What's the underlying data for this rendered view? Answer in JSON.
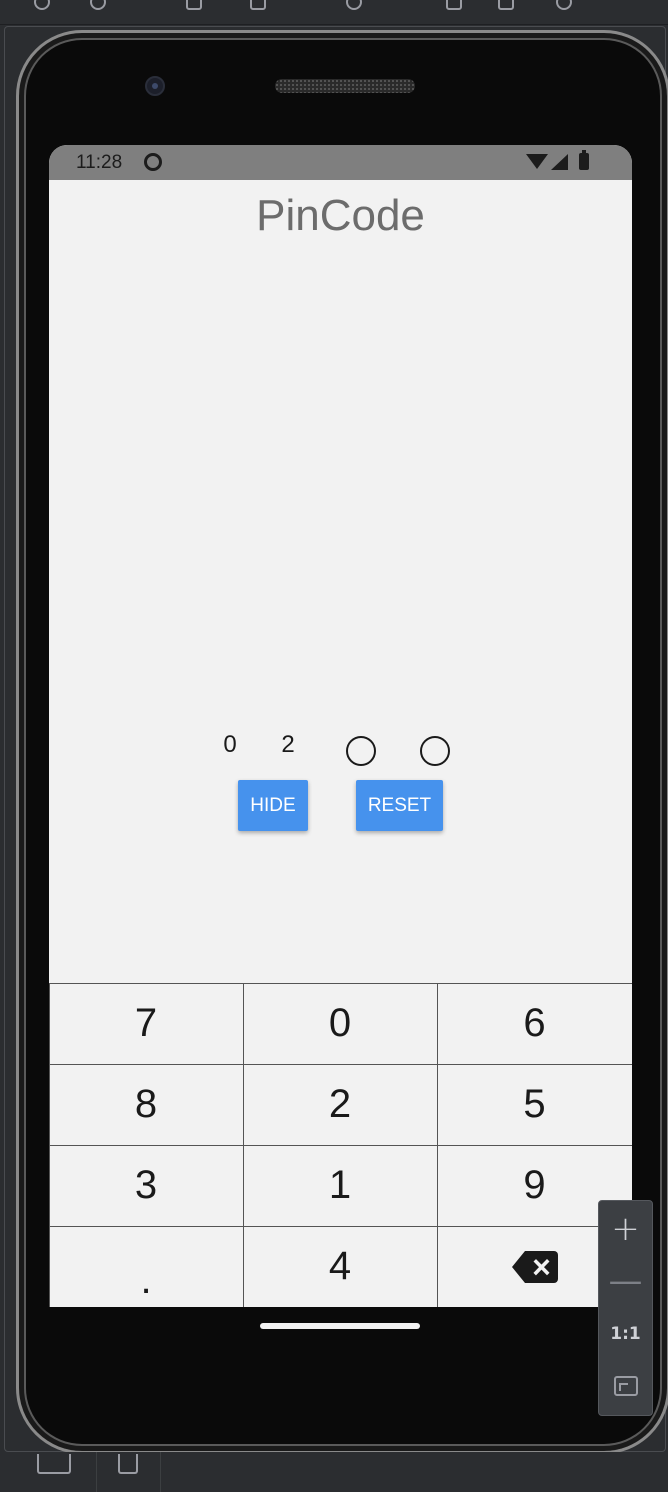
{
  "status_bar": {
    "time": "11:28"
  },
  "app": {
    "title": "PinCode"
  },
  "pin": {
    "digits": [
      "0",
      "2"
    ],
    "empty_slots": 2
  },
  "buttons": {
    "hide": "HIDE",
    "reset": "RESET"
  },
  "keypad": {
    "keys": [
      "7",
      "0",
      "6",
      "8",
      "2",
      "5",
      "3",
      "1",
      "9",
      ".",
      "4"
    ],
    "backspace_icon": "backspace-icon"
  },
  "emulator_zoom": {
    "zoom_in": "+",
    "zoom_out": "—",
    "actual_size": "1:1"
  }
}
